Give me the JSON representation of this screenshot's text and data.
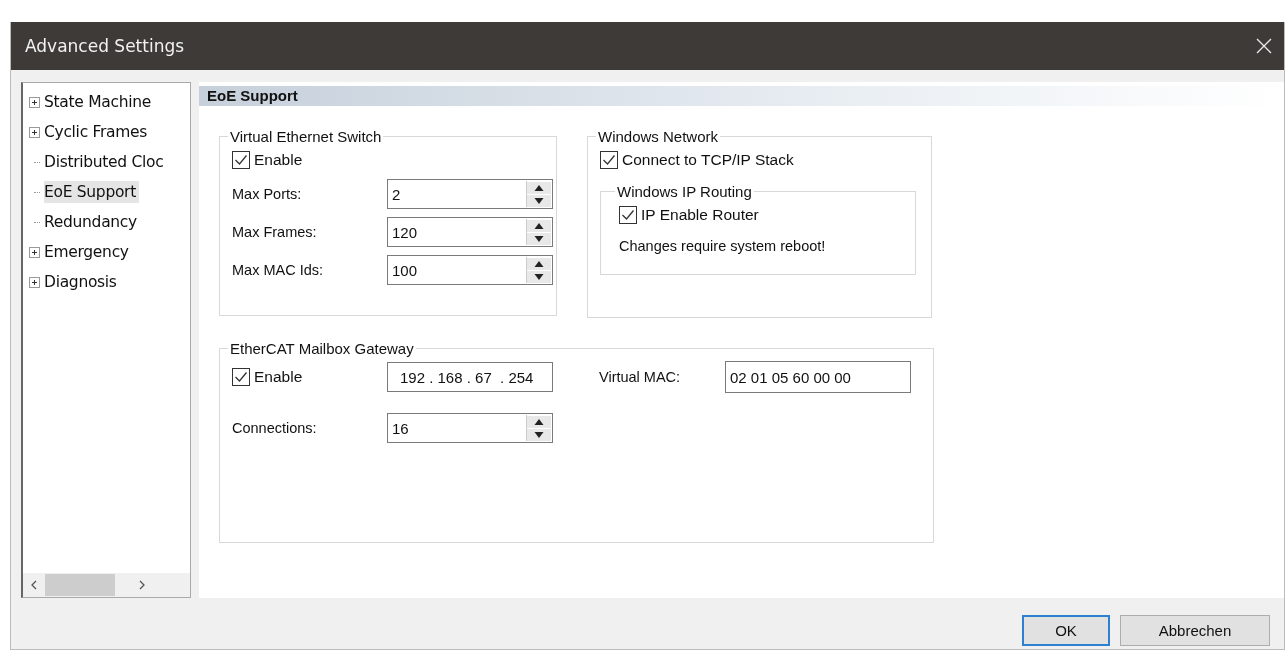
{
  "window": {
    "title": "Advanced Settings"
  },
  "tree": {
    "items": [
      {
        "label": "State Machine",
        "kind": "folder",
        "expanded": false,
        "selected": false
      },
      {
        "label": "Cyclic Frames",
        "kind": "folder",
        "expanded": false,
        "selected": false
      },
      {
        "label": "Distributed Cloc",
        "kind": "leaf",
        "selected": false
      },
      {
        "label": "EoE Support",
        "kind": "leaf",
        "selected": true
      },
      {
        "label": "Redundancy",
        "kind": "leaf",
        "selected": false
      },
      {
        "label": "Emergency",
        "kind": "folder",
        "expanded": false,
        "selected": false
      },
      {
        "label": "Diagnosis",
        "kind": "folder",
        "expanded": false,
        "selected": false
      }
    ]
  },
  "panel": {
    "title": "EoE Support",
    "virtual_ethernet_switch": {
      "title": "Virtual Ethernet Switch",
      "enable": {
        "label": "Enable",
        "checked": true
      },
      "fields": [
        {
          "label": "Max Ports:",
          "value": "2"
        },
        {
          "label": "Max Frames:",
          "value": "120"
        },
        {
          "label": "Max MAC Ids:",
          "value": "100"
        }
      ]
    },
    "windows_network": {
      "title": "Windows Network",
      "connect": {
        "label": "Connect to TCP/IP Stack",
        "checked": true
      },
      "ip_routing": {
        "title": "Windows IP Routing",
        "enable_router": {
          "label": "IP Enable Router",
          "checked": true
        },
        "note": "Changes require system reboot!"
      }
    },
    "mailbox_gateway": {
      "title": "EtherCAT Mailbox Gateway",
      "enable": {
        "label": "Enable",
        "checked": true
      },
      "ip_address": "192 . 168 . 67  . 254",
      "virtual_mac": {
        "label": "Virtual MAC:",
        "value": "02 01 05 60 00 00"
      },
      "connections": {
        "label": "Connections:",
        "value": "16"
      }
    }
  },
  "buttons": [
    {
      "label": "OK",
      "default": true
    },
    {
      "label": "Abbrechen",
      "default": false
    }
  ]
}
